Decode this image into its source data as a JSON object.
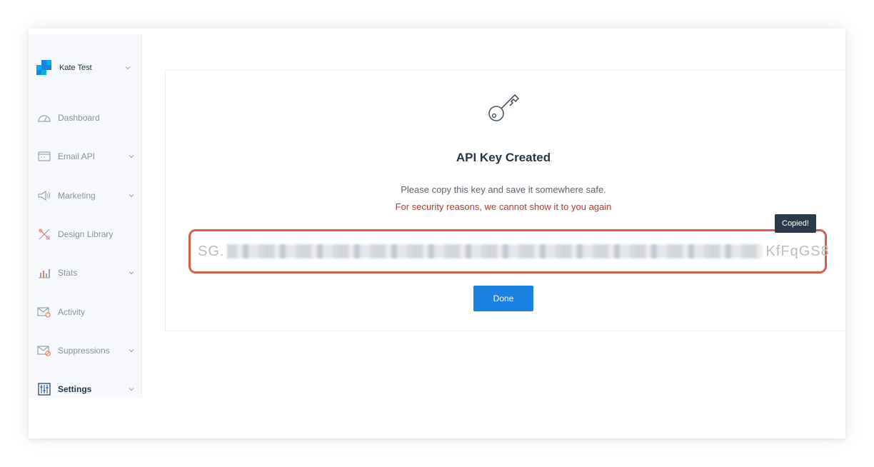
{
  "sidebar": {
    "account": {
      "name": "Kate Test"
    },
    "items": [
      {
        "label": "Dashboard",
        "icon": "dashboard-gauge-icon",
        "has_chevron": false
      },
      {
        "label": "Email API",
        "icon": "email-api-icon",
        "has_chevron": true
      },
      {
        "label": "Marketing",
        "icon": "megaphone-icon",
        "has_chevron": true
      },
      {
        "label": "Design Library",
        "icon": "design-tools-icon",
        "has_chevron": false
      },
      {
        "label": "Stats",
        "icon": "bar-chart-icon",
        "has_chevron": true
      },
      {
        "label": "Activity",
        "icon": "activity-envelope-icon",
        "has_chevron": false
      },
      {
        "label": "Suppressions",
        "icon": "suppressions-envelope-icon",
        "has_chevron": true
      },
      {
        "label": "Settings",
        "icon": "settings-sliders-icon",
        "has_chevron": true,
        "active": true
      }
    ]
  },
  "dialog": {
    "icon": "key-icon",
    "title": "API Key Created",
    "description": "Please copy this key and save it somewhere safe.",
    "warning": "For security reasons, we cannot show it to you again",
    "tooltip": "Copied!",
    "api_key_prefix": "SG.",
    "api_key_suffix": "KfFqGS8",
    "done_label": "Done"
  },
  "colors": {
    "accent": "#1a82e2",
    "warning": "#c0392b",
    "highlight": "#d35f4a",
    "tooltip_bg": "#2b3a49",
    "text": "#263746"
  }
}
